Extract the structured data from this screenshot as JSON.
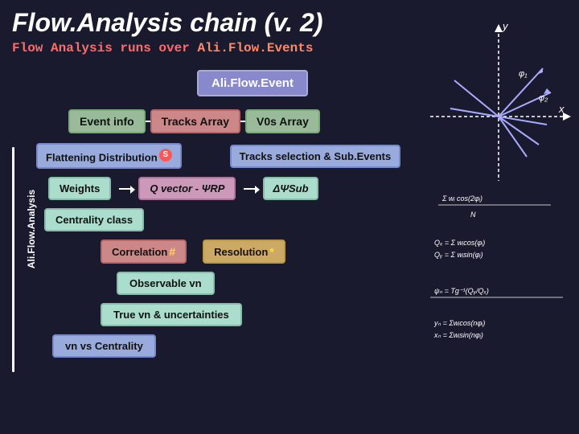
{
  "title": "Flow.Analysis chain (v. 2)",
  "subtitle_prefix": "Flow Analysis runs over ",
  "subtitle_highlight": "Ali.Flow.Events",
  "aliflow_label": "Ali.Flow.Event",
  "event_info_label": "Event info",
  "tracks_array_label": "Tracks Array",
  "v0s_array_label": "V0s Array",
  "flattening_label": "Flattening Distribution",
  "tracks_selection_label": "Tracks selection & Sub.Events",
  "weights_label": "Weights",
  "qvector_label": "Q vector - ΨRP",
  "delta_psi_label": "ΔΨSub",
  "centrality_label": "Centrality class",
  "correlation_label": "Correlation",
  "resolution_label": "Resolution",
  "observable_label": "Observable vn",
  "true_vn_label": "True vn & uncertainties",
  "vn_centrality_label": "vn vs Centrality",
  "side_label": "Ali.Flow.Analysis",
  "colors": {
    "background": "#1a1a2e",
    "aliflow_box": "#8888cc",
    "event_box": "#99bb99",
    "tracks_box": "#cc8888",
    "flow_box": "#99aadd",
    "green_box": "#aaddcc",
    "purple_box": "#cc99bb",
    "orange_box": "#ccaa66",
    "red_box": "#cc8888"
  }
}
